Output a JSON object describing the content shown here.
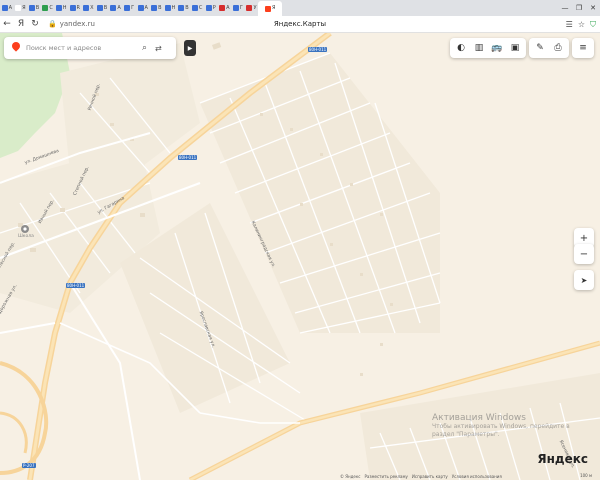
{
  "browser": {
    "tabs": [
      {
        "letter": "A",
        "color": "#3a6fd8"
      },
      {
        "letter": "Я",
        "color": "#ffffff"
      },
      {
        "letter": "В",
        "color": "#3a6fd8"
      },
      {
        "letter": "С",
        "color": "#2e9e4e"
      },
      {
        "letter": "Н",
        "color": "#3a6fd8"
      },
      {
        "letter": "R",
        "color": "#3a6fd8"
      },
      {
        "letter": "Х",
        "color": "#3a6fd8"
      },
      {
        "letter": "В",
        "color": "#3a6fd8"
      },
      {
        "letter": "А",
        "color": "#3a6fd8"
      },
      {
        "letter": "Г",
        "color": "#3a6fd8"
      },
      {
        "letter": "А",
        "color": "#3a6fd8"
      },
      {
        "letter": "В",
        "color": "#3a6fd8"
      },
      {
        "letter": "Н",
        "color": "#3a6fd8"
      },
      {
        "letter": "В",
        "color": "#3a6fd8"
      },
      {
        "letter": "С",
        "color": "#3a6fd8"
      },
      {
        "letter": "Р",
        "color": "#3a6fd8"
      },
      {
        "letter": "А",
        "color": "#d62d2d"
      },
      {
        "letter": "Г",
        "color": "#3a6fd8"
      },
      {
        "letter": "У",
        "color": "#d62d2d"
      }
    ],
    "active_tab": {
      "letter": "Я"
    },
    "url": "yandex.ru",
    "page_title": "Яндекс.Карты",
    "back": "←",
    "ya": "Я",
    "reload": "↻",
    "lock": "🔒",
    "minimize": "—",
    "maximize": "❐",
    "close": "✕"
  },
  "search": {
    "placeholder": "Поиск мест и адресов",
    "search_icon": "⌕",
    "route_icon": "⇄"
  },
  "toolbar": {
    "traffic": "◐",
    "panorama": "▥",
    "transit": "🚌",
    "layers": "▣",
    "ruler": "✎",
    "print": "⎙",
    "menu": "≡"
  },
  "map_controls": {
    "zoom_in": "+",
    "zoom_out": "−",
    "geolocate": "➤"
  },
  "map_labels": {
    "road_p1": "Речной пер.",
    "road_domashneva": "ул. Домашнева",
    "road_stepnoy": "Степной пер.",
    "road_gagarina": "ул. Гагарина",
    "road_ivnoy": "Ивный пер.",
    "road_dorozhnaya": "Дорожная ул.",
    "road_lesnoy": "Лесной пер.",
    "road_kalinin": "Калининградская ул.",
    "road_yaroslav": "Ярославская ул.",
    "road_yasnaya": "Ясеневая ул.",
    "route_1": "80Н-011",
    "route_2": "80Н-011",
    "route_3": "80Н-011",
    "route_4": "Р-207",
    "poi_school": "Школа"
  },
  "watermark": {
    "title": "Активация Windows",
    "sub1": "Чтобы активировать Windows, перейдите в",
    "sub2": "раздел \"Параметры\"."
  },
  "footer": {
    "copyright": "© Яндекс",
    "ads": "Разместить рекламу",
    "correct": "Исправить карту",
    "conditions": "Условия использования",
    "scale": "100 м"
  },
  "brand": "Яндекс"
}
